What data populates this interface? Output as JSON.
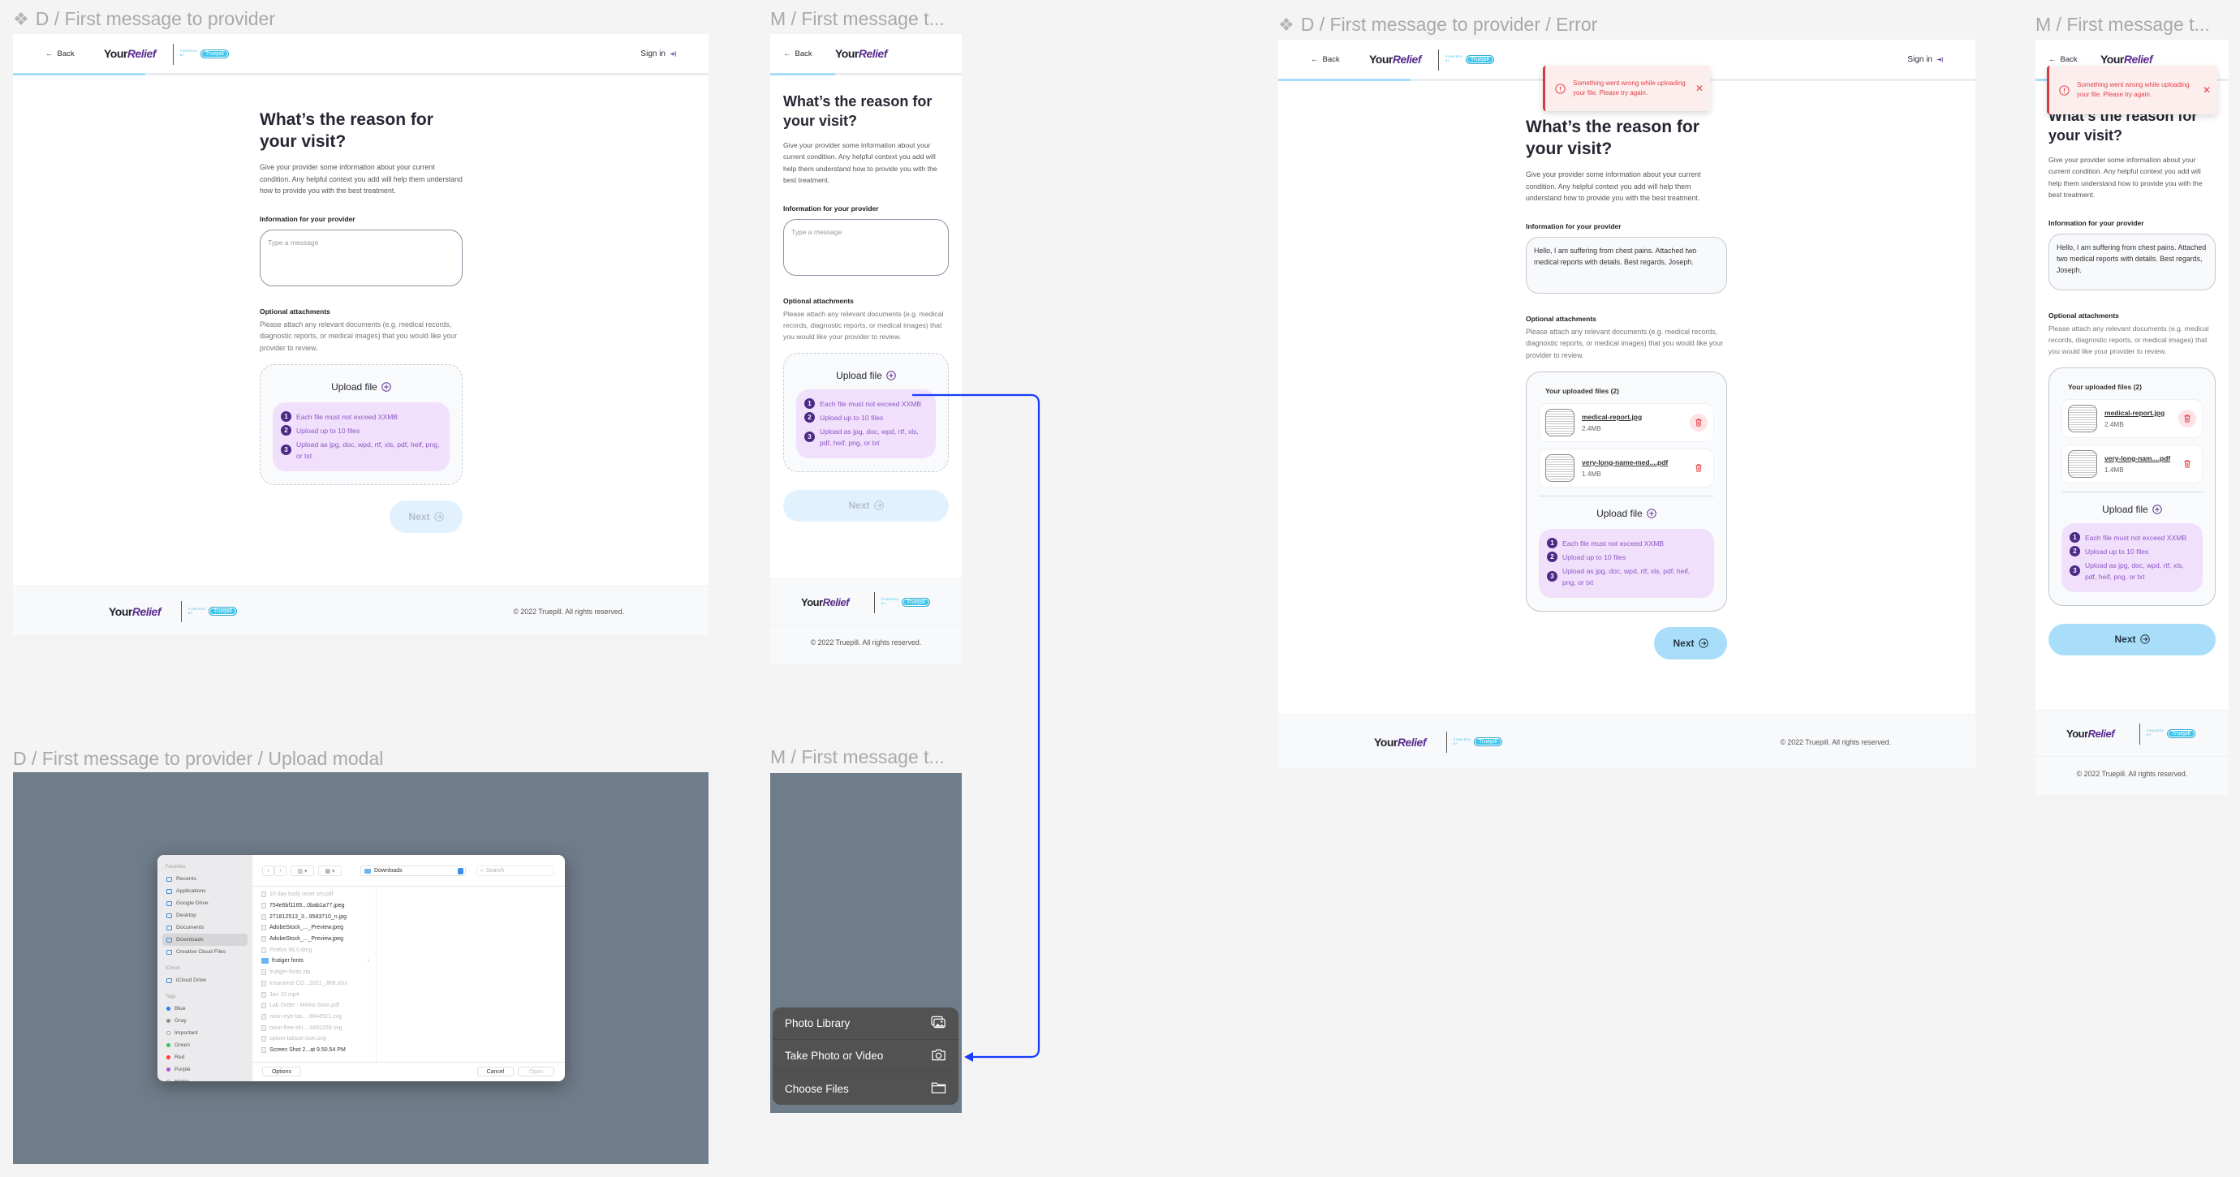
{
  "frame_labels": {
    "desktop": "D / First message to provider",
    "mobile": "M / First message t...",
    "desktop_error": "D / First message to provider / Error",
    "mobile_error": "M / First message t...",
    "desktop_modal": "D / First message to provider / Upload modal",
    "mobile_modal": "M / First message t..."
  },
  "brand": {
    "your": "Your",
    "relief": "Relief",
    "powered_by": "POWERED BY",
    "truepill": "Truepill"
  },
  "header": {
    "back": "Back",
    "sign_in": "Sign in",
    "progress_fraction_desktop": 0.19,
    "progress_fraction_mobile": 0.34
  },
  "form": {
    "title": "What’s the reason for your visit?",
    "description": "Give your provider some information about your current condition. Any helpful context you add will help them understand how to provide you with the best treatment.",
    "info_label": "Information for your provider",
    "placeholder": "Type a message",
    "filled_message": "Hello, I am suffering from chest pains. Attached two medical reports with details. Best regards, Joseph.",
    "attachments_label": "Optional attachments",
    "attachments_desc": "Please attach any relevant documents (e.g. medical records, diagnostic reports, or medical images) that you would like your provider to review.",
    "upload_label": "Upload file",
    "rules": [
      {
        "n": "1",
        "text": "Each file must not exceed XXMB"
      },
      {
        "n": "2",
        "text": "Upload up to 10 files"
      },
      {
        "n": "3",
        "text": "Upload as jpg, doc, wpd, rtf, xls, pdf, heif, png, or txt"
      }
    ],
    "next": "Next"
  },
  "uploaded": {
    "title": "Your uploaded files (2)",
    "files": [
      {
        "name": "medical-report.jpg",
        "mobile_name": "medical-report.jpg",
        "size": "2.4MB"
      },
      {
        "name": "very-long-name-med....pdf",
        "mobile_name": "very-long-nam....pdf",
        "size": "1.4MB"
      }
    ]
  },
  "error_toast": {
    "message": "Something went wrong while uploading your file. Please try again."
  },
  "footer": {
    "copyright": "© 2022 Truepill. All rights reserved."
  },
  "file_dialog": {
    "sections": [
      {
        "title": "Favorites",
        "items": [
          {
            "label": "Recents"
          },
          {
            "label": "Applications"
          },
          {
            "label": "Google Drive"
          },
          {
            "label": "Desktop"
          },
          {
            "label": "Documents"
          },
          {
            "label": "Downloads",
            "selected": true
          },
          {
            "label": "Creative Cloud Files"
          }
        ]
      },
      {
        "title": "iCloud",
        "items": [
          {
            "label": "iCloud Drive"
          }
        ]
      },
      {
        "title": "Tags",
        "items": [
          {
            "label": "Blue",
            "color": "#2f7bf5"
          },
          {
            "label": "Gray",
            "color": "#8e8e8e"
          },
          {
            "label": "Important",
            "color": "#ffffff"
          },
          {
            "label": "Green",
            "color": "#34c759"
          },
          {
            "label": "Red",
            "color": "#ff3b30"
          },
          {
            "label": "Purple",
            "color": "#af52de"
          },
          {
            "label": "Home",
            "color": "#ffffff"
          }
        ]
      }
    ],
    "location": "Downloads",
    "search_placeholder": "Search",
    "files": [
      {
        "name": "10 day body reset sm.pdf",
        "dim": true
      },
      {
        "name": "754e6bf1165...0bab1a77.jpeg",
        "dim": false
      },
      {
        "name": "271812513_3...9583710_n.jpg",
        "dim": false
      },
      {
        "name": "AdobeStock_..._Preview.jpeg",
        "dim": false
      },
      {
        "name": "AdobeStock_..._Preview.jpeg",
        "dim": false
      },
      {
        "name": "Firefox 96.0.dmg",
        "dim": true
      },
      {
        "name": "frutiger fonts",
        "dim": false,
        "folder": true
      },
      {
        "name": "frutiger-fonts.zip",
        "dim": true
      },
      {
        "name": "Insurance CO...2021_JRB.xlsx",
        "dim": true
      },
      {
        "name": "Jan 10.mp4",
        "dim": true
      },
      {
        "name": "Lab Order - Mieko Saito.pdf",
        "dim": true
      },
      {
        "name": "noun-eye-las...-3644521.svg",
        "dim": true
      },
      {
        "name": "noun-free-shi...-3492259.svg",
        "dim": true
      },
      {
        "name": "optum-latisse-icon.svg",
        "dim": true
      },
      {
        "name": "Screen Shot 2...at 9.50.54 PM",
        "dim": false
      }
    ],
    "options": "Options",
    "cancel": "Cancel",
    "open": "Open"
  },
  "action_sheet": {
    "items": [
      {
        "label": "Photo Library",
        "icon": "photo-library-icon"
      },
      {
        "label": "Take Photo or Video",
        "icon": "camera-icon"
      },
      {
        "label": "Choose Files",
        "icon": "folder-icon"
      }
    ]
  },
  "colors": {
    "brand_purple": "#5b2d90",
    "info_bg": "#f0e0fc",
    "next_disabled": "#e1f1fd",
    "next_active": "#a8defa",
    "error": "#e0434a",
    "overlay": "#6f7c89",
    "flow_arrow": "#1a3cff"
  }
}
